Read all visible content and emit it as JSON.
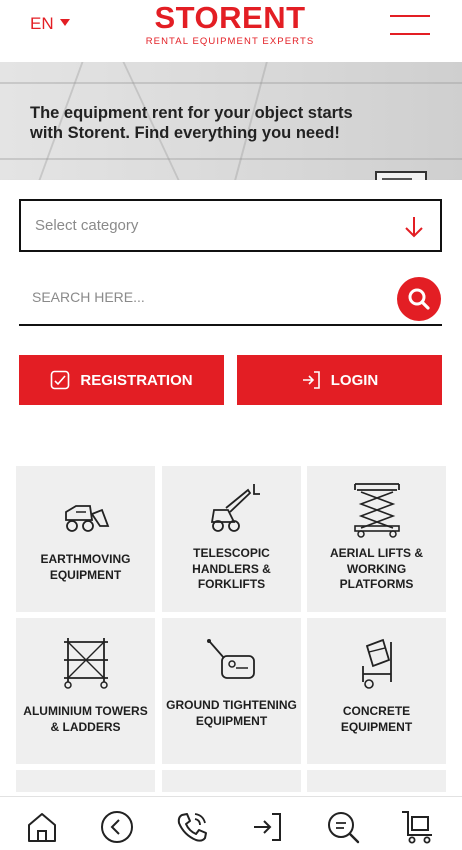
{
  "header": {
    "language": "EN",
    "logo_word": "STORENT",
    "logo_tagline": "RENTAL EQUIPMENT EXPERTS"
  },
  "banner": {
    "text": "The equipment rent for your object starts with Storent. Find everything you need!"
  },
  "search": {
    "category_placeholder": "Select category",
    "search_placeholder": "SEARCH HERE..."
  },
  "buttons": {
    "registration": "REGISTRATION",
    "login": "LOGIN"
  },
  "categories": [
    {
      "label": "EARTHMOVING EQUIPMENT",
      "icon": "excavator-icon"
    },
    {
      "label": "TELESCOPIC HANDLERS & FORKLIFTS",
      "icon": "telehandler-icon"
    },
    {
      "label": "AERIAL LIFTS & WORKING PLATFORMS",
      "icon": "scissor-lift-icon"
    },
    {
      "label": "ALUMINIUM TOWERS & LADDERS",
      "icon": "scaffold-tower-icon"
    },
    {
      "label": "GROUND TIGHTENING EQUIPMENT",
      "icon": "plate-compactor-icon"
    },
    {
      "label": "CONCRETE EQUIPMENT",
      "icon": "concrete-mixer-icon"
    }
  ],
  "bottom_nav": [
    "home-icon",
    "back-icon",
    "phone-icon",
    "login-icon",
    "search-icon",
    "cart-icon"
  ],
  "colors": {
    "brand_red": "#e31e24",
    "tile_bg": "#efefef",
    "text_dark": "#1e1e1e"
  }
}
